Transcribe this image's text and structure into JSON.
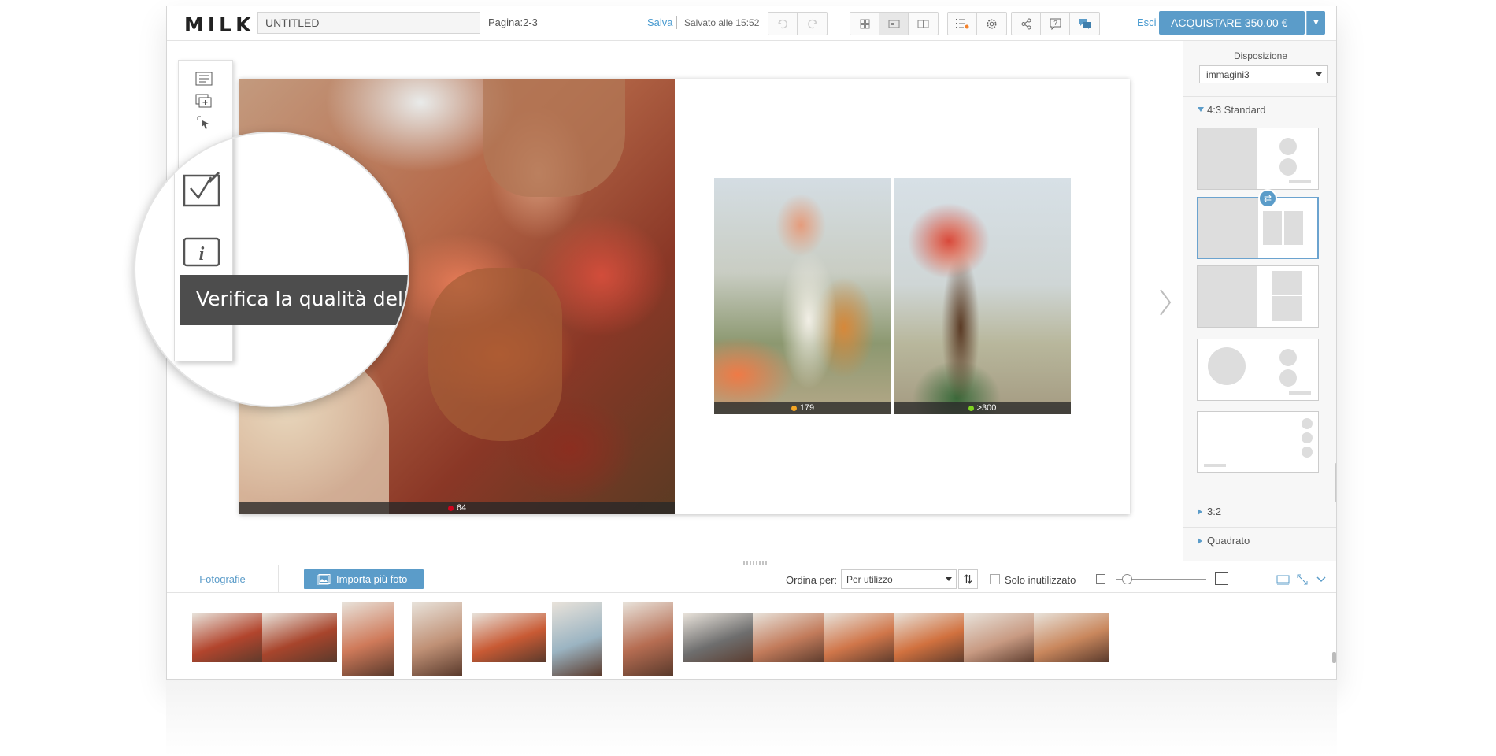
{
  "app": {
    "logo": "MILK",
    "project_title": "UNTITLED",
    "page_label": "Pagina:2-3",
    "save_link": "Salva",
    "saved_status": "Salvato alle 15:52",
    "exit_link": "Esci",
    "buy_button": "ACQUISTARE 350,00 €"
  },
  "colors": {
    "accent": "#5b9cc9",
    "badge_orange": "#f5a623",
    "badge_red": "#d0021b",
    "badge_green": "#7ed321"
  },
  "toolbar_icons": [
    "text-icon",
    "add-page-icon",
    "select-icon",
    "quality-check-icon",
    "info-icon"
  ],
  "magnifier": {
    "tooltip": "Verifica la qualità delle im"
  },
  "spread": {
    "main_photo_quality": "64",
    "photo_left_quality": "179",
    "photo_right_quality": ">300"
  },
  "right_panel": {
    "heading": "Disposizione",
    "layout_select": "immagini3",
    "sections": {
      "standard": "4:3 Standard",
      "ratio32": "3:2",
      "square": "Quadrato"
    }
  },
  "bottom": {
    "tab_photos": "Fotografie",
    "import_button": "Importa più foto",
    "sort_label": "Ordina per:",
    "sort_value": "Per utilizzo",
    "unused_only": "Solo inutilizzato"
  },
  "filmstrip": [
    {
      "name": "thumb-1",
      "color": "#b2452d"
    },
    {
      "name": "thumb-2",
      "color": "#a8452c"
    },
    {
      "name": "thumb-3",
      "color": "#cf7a5a"
    },
    {
      "name": "thumb-4",
      "color": "#c09176"
    },
    {
      "name": "thumb-5",
      "color": "#c85a34"
    },
    {
      "name": "thumb-6",
      "color": "#9bb4c2"
    },
    {
      "name": "thumb-7",
      "color": "#b66d52"
    },
    {
      "name": "thumb-8",
      "color": "#6e6e6e"
    },
    {
      "name": "thumb-9",
      "color": "#c27b5b"
    },
    {
      "name": "thumb-10",
      "color": "#d0764a"
    },
    {
      "name": "thumb-11",
      "color": "#d1713f"
    },
    {
      "name": "thumb-12",
      "color": "#c89a82"
    },
    {
      "name": "thumb-13",
      "color": "#c9875d"
    }
  ]
}
